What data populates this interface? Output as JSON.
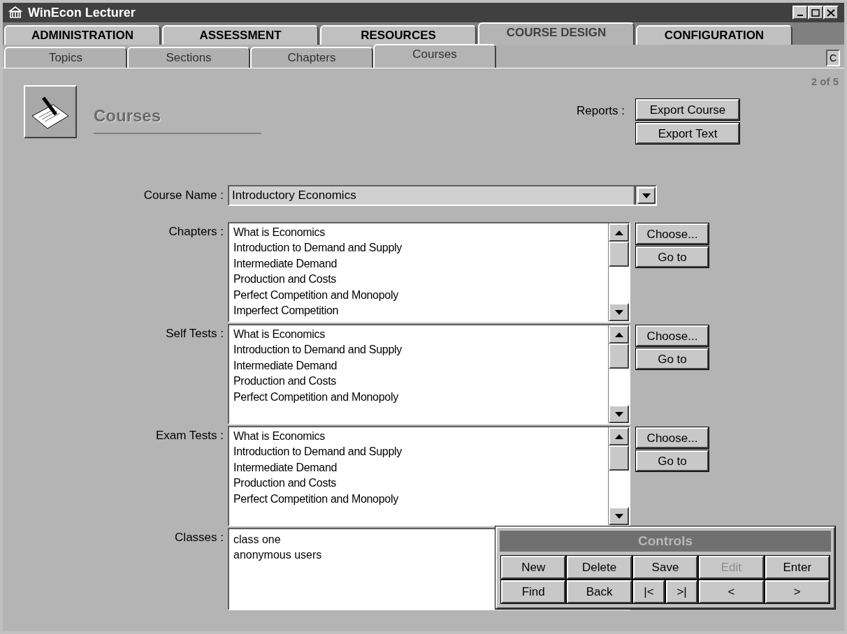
{
  "window": {
    "title": "WinEcon Lecturer"
  },
  "main_tabs": [
    {
      "label": "ADMINISTRATION",
      "selected": false
    },
    {
      "label": "ASSESSMENT",
      "selected": false
    },
    {
      "label": "RESOURCES",
      "selected": false
    },
    {
      "label": "COURSE DESIGN",
      "selected": true
    },
    {
      "label": "CONFIGURATION",
      "selected": false
    }
  ],
  "sub_tabs": [
    {
      "label": "Topics",
      "selected": false
    },
    {
      "label": "Sections",
      "selected": false
    },
    {
      "label": "Chapters",
      "selected": false
    },
    {
      "label": "Courses",
      "selected": true
    }
  ],
  "corner_button": "C",
  "record_position": "2 of 5",
  "page_title": "Courses",
  "reports": {
    "label": "Reports :",
    "buttons": [
      "Export Course",
      "Export Text"
    ]
  },
  "course_name": {
    "label": "Course Name :",
    "value": "Introductory Economics"
  },
  "lists": [
    {
      "label": "Chapters :",
      "items": [
        "What is Economics",
        "Introduction to Demand and Supply",
        "Intermediate Demand",
        "Production and Costs",
        "Perfect Competition and Monopoly",
        "Imperfect Competition"
      ],
      "buttons": [
        "Choose...",
        "Go to"
      ]
    },
    {
      "label": "Self Tests :",
      "items": [
        "What is Economics",
        "Introduction to Demand and Supply",
        "Intermediate Demand",
        "Production and Costs",
        "Perfect Competition and Monopoly"
      ],
      "buttons": [
        "Choose...",
        "Go to"
      ]
    },
    {
      "label": "Exam Tests :",
      "items": [
        "What is Economics",
        "Introduction to Demand and Supply",
        "Intermediate Demand",
        "Production and Costs",
        "Perfect Competition and Monopoly"
      ],
      "buttons": [
        "Choose...",
        "Go to"
      ]
    }
  ],
  "classes": {
    "label": "Classes :",
    "items": [
      "class one",
      "anonymous users"
    ]
  },
  "controls": {
    "title": "Controls",
    "buttons": [
      {
        "label": "New",
        "kind": "wide",
        "disabled": false
      },
      {
        "label": "Delete",
        "kind": "wide",
        "disabled": false
      },
      {
        "label": "Save",
        "kind": "wide",
        "disabled": false
      },
      {
        "label": "Edit",
        "kind": "wide",
        "disabled": true
      },
      {
        "label": "Enter",
        "kind": "wide",
        "disabled": false
      },
      {
        "label": "Find",
        "kind": "wide",
        "disabled": false
      },
      {
        "label": "Back",
        "kind": "wide",
        "disabled": false
      },
      {
        "label": "|<",
        "kind": "half",
        "disabled": false
      },
      {
        "label": ">|",
        "kind": "half",
        "disabled": false
      },
      {
        "label": "<",
        "kind": "wide",
        "disabled": false
      },
      {
        "label": ">",
        "kind": "wide",
        "disabled": false
      }
    ]
  }
}
